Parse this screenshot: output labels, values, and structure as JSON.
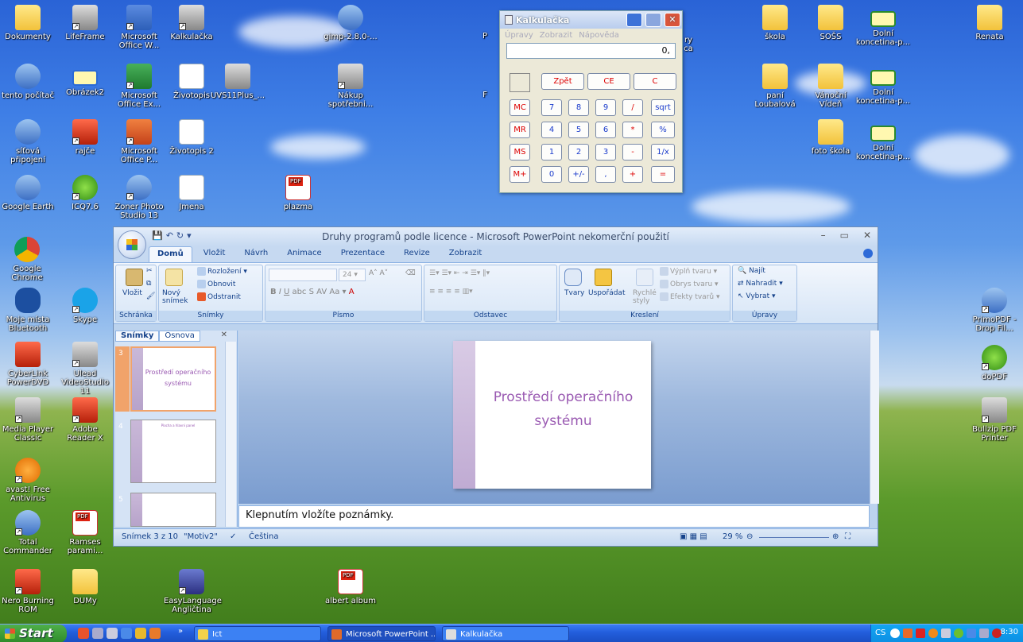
{
  "desktop": {
    "icons": [
      {
        "label": "Dokumenty"
      },
      {
        "label": "LifeFrame"
      },
      {
        "label": "Microsoft Office W..."
      },
      {
        "label": "Kalkulačka"
      },
      {
        "label": "gimp-2.8.0-..."
      },
      {
        "label": "tento počítač"
      },
      {
        "label": "Obrázek2"
      },
      {
        "label": "Microsoft Office Ex..."
      },
      {
        "label": "Životopis"
      },
      {
        "label": "UVS11Plus_..."
      },
      {
        "label": "Nákup spotřebni..."
      },
      {
        "label": "síťová připojení"
      },
      {
        "label": "rajče"
      },
      {
        "label": "Microsoft Office P..."
      },
      {
        "label": "Životopis 2"
      },
      {
        "label": "Google Earth"
      },
      {
        "label": "ICQ7.6"
      },
      {
        "label": "Zoner Photo Studio 13"
      },
      {
        "label": "Jmena"
      },
      {
        "label": "plazma"
      },
      {
        "label": "Google Chrome"
      },
      {
        "label": "Moje místa Bluetooth"
      },
      {
        "label": "Skype"
      },
      {
        "label": "CyberLink PowerDVD"
      },
      {
        "label": "Ulead VideoStudio 11"
      },
      {
        "label": "Media Player Classic"
      },
      {
        "label": "Adobe Reader X"
      },
      {
        "label": "avast! Free Antivirus"
      },
      {
        "label": "Total Commander"
      },
      {
        "label": "Ramses parami..."
      },
      {
        "label": "Nero Burning ROM"
      },
      {
        "label": "DUMy"
      },
      {
        "label": "EasyLanguage Angličtina"
      },
      {
        "label": "albert album"
      },
      {
        "label": "škola"
      },
      {
        "label": "SOŠS"
      },
      {
        "label": "Dolní koncetina-p..."
      },
      {
        "label": "Renata"
      },
      {
        "label": "paní Loubalová"
      },
      {
        "label": "Vánoční Vídeň"
      },
      {
        "label": "Dolní koncetina-p..."
      },
      {
        "label": "foto škola"
      },
      {
        "label": "Dolní koncetina-p..."
      },
      {
        "label": "PrimoPDF - Drop Fil..."
      },
      {
        "label": "doPDF"
      },
      {
        "label": "Bullzip PDF Printer"
      }
    ],
    "partial_labels": [
      "P",
      "F",
      "ry",
      "ca"
    ]
  },
  "calculator": {
    "title": "Kalkulačka",
    "menu": [
      "Úpravy",
      "Zobrazit",
      "Nápověda"
    ],
    "display": "0,",
    "buttons": {
      "back": "Zpět",
      "ce": "CE",
      "c": "C",
      "mc": "MC",
      "mr": "MR",
      "ms": "MS",
      "mplus": "M+",
      "n7": "7",
      "n8": "8",
      "n9": "9",
      "div": "/",
      "sqrt": "sqrt",
      "n4": "4",
      "n5": "5",
      "n6": "6",
      "mul": "*",
      "pct": "%",
      "n1": "1",
      "n2": "2",
      "n3": "3",
      "sub": "-",
      "inv": "1/x",
      "n0": "0",
      "sign": "+/-",
      "dot": ",",
      "add": "+",
      "eq": "="
    }
  },
  "powerpoint": {
    "title": "Druhy programů podle licence - Microsoft PowerPoint nekomerční použití",
    "tabs": [
      "Domů",
      "Vložit",
      "Návrh",
      "Animace",
      "Prezentace",
      "Revize",
      "Zobrazit"
    ],
    "ribbon": {
      "clipboard": {
        "paste": "Vložit",
        "label": "Schránka"
      },
      "slides": {
        "new_slide": "Nový snímek",
        "layout": "Rozložení",
        "reset": "Obnovit",
        "delete": "Odstranit",
        "label": "Snímky"
      },
      "font": {
        "size": "24",
        "label": "Písmo"
      },
      "paragraph": {
        "label": "Odstavec"
      },
      "drawing": {
        "shapes": "Tvary",
        "arrange": "Uspořádat",
        "quick_styles": "Rychlé styly",
        "fill": "Výplň tvaru",
        "outline": "Obrys tvaru",
        "effects": "Efekty tvarů",
        "label": "Kreslení"
      },
      "editing": {
        "find": "Najít",
        "replace": "Nahradit",
        "select": "Vybrat",
        "label": "Úpravy"
      }
    },
    "pane_tabs": [
      "Snímky",
      "Osnova"
    ],
    "thumbnails": [
      {
        "num": "3",
        "text": "Prostředí operačního systému"
      },
      {
        "num": "4",
        "text": "Plocha a hlavní panel"
      },
      {
        "num": "5",
        "text": ""
      }
    ],
    "slide_title": "Prostředí operačního systému",
    "notes_placeholder": "Klepnutím vložíte poznámky.",
    "status": {
      "slide": "Snímek 3 z 10",
      "theme": "\"Motiv2\"",
      "language": "Čeština",
      "zoom": "29 %"
    }
  },
  "taskbar": {
    "start": "Start",
    "tasks": [
      "Ict",
      "Microsoft PowerPoint ...",
      "Kalkulačka"
    ],
    "lang": "CS",
    "clock": "8:30"
  }
}
